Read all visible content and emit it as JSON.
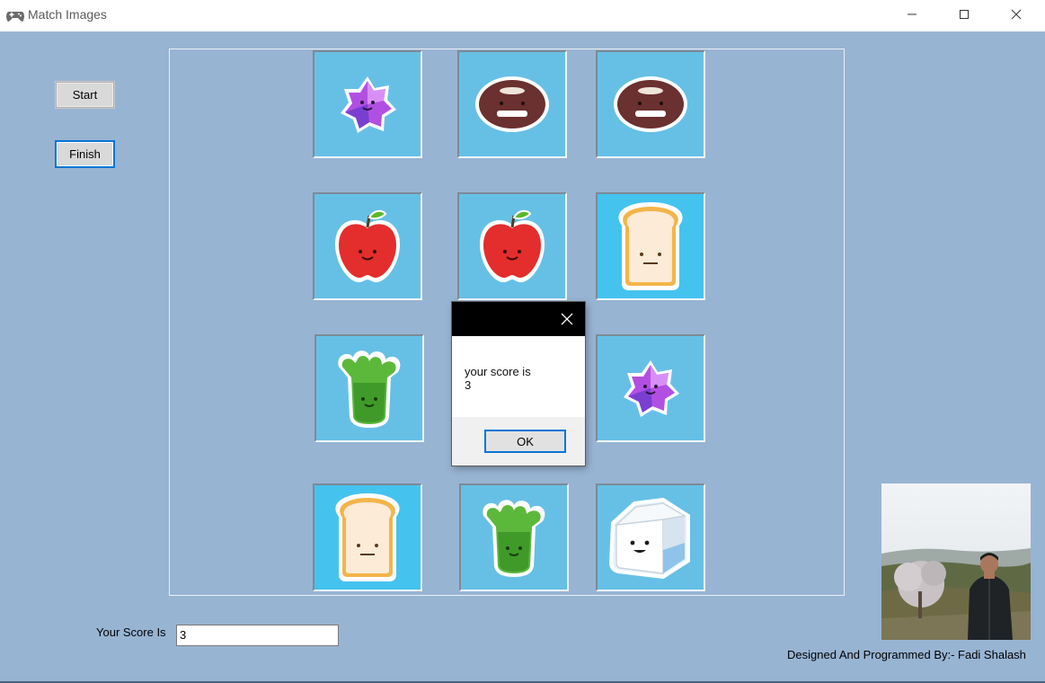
{
  "window": {
    "title": "Match Images",
    "icon": "gamepad-icon"
  },
  "controls": {
    "start_label": "Start",
    "finish_label": "Finish"
  },
  "board": {
    "tiles": [
      {
        "row": 1,
        "col": 1,
        "image": "purple-star-candy"
      },
      {
        "row": 1,
        "col": 2,
        "image": "coconut"
      },
      {
        "row": 1,
        "col": 3,
        "image": "coconut"
      },
      {
        "row": 2,
        "col": 1,
        "image": "apple"
      },
      {
        "row": 2,
        "col": 2,
        "image": "apple"
      },
      {
        "row": 2,
        "col": 3,
        "image": "toast"
      },
      {
        "row": 3,
        "col": 1,
        "image": "broccoli"
      },
      {
        "row": 3,
        "col": 2,
        "image": "hidden-behind-dialog"
      },
      {
        "row": 3,
        "col": 3,
        "image": "purple-star-candy"
      },
      {
        "row": 4,
        "col": 1,
        "image": "toast"
      },
      {
        "row": 4,
        "col": 2,
        "image": "broccoli"
      },
      {
        "row": 4,
        "col": 3,
        "image": "milk-carton"
      }
    ]
  },
  "score": {
    "label": "Your Score Is",
    "value": "3"
  },
  "credit": "Designed And Programmed By:- Fadi Shalash",
  "photo": {
    "image": "developer-photo"
  },
  "dialog": {
    "message_line1": "your score is",
    "message_line2": "3",
    "ok_label": "OK"
  }
}
